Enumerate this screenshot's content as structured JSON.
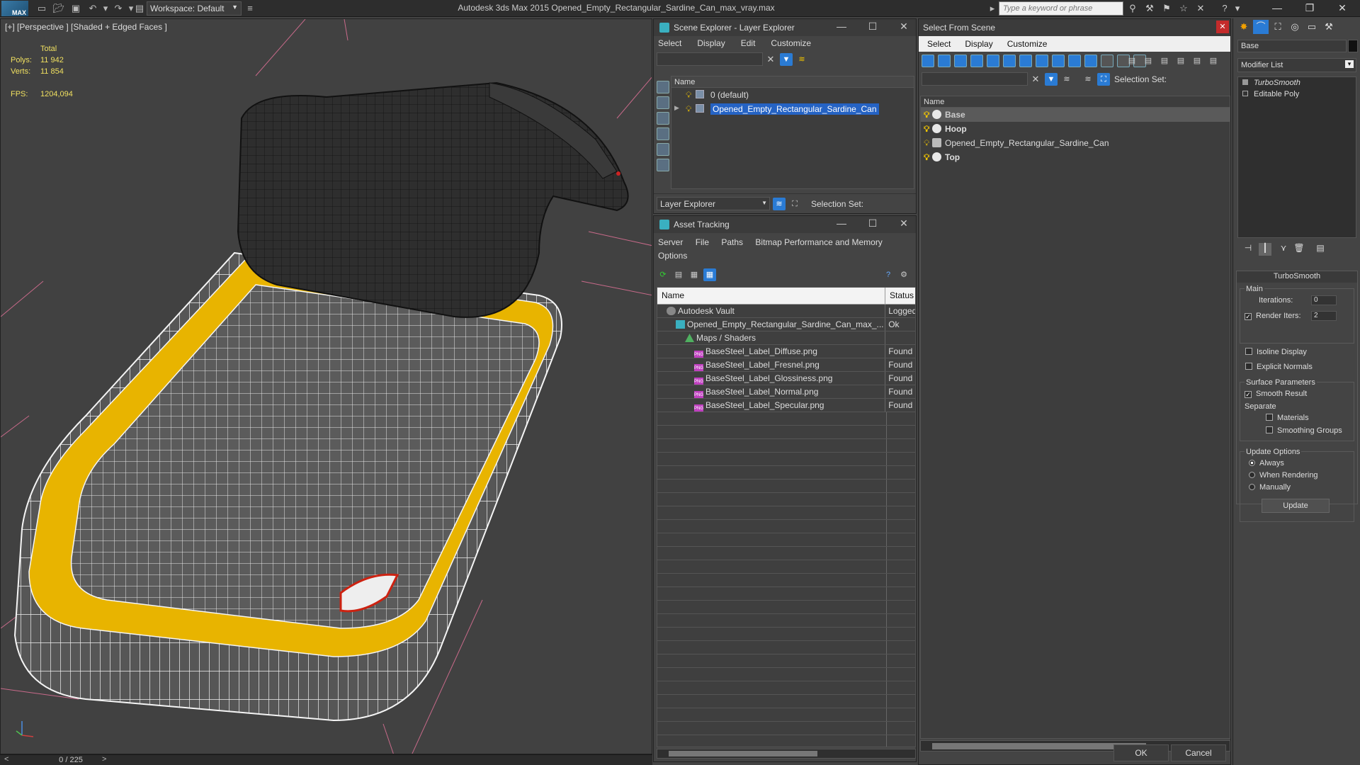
{
  "titlebar": {
    "logo_text": "MAX",
    "workspace": "Workspace: Default",
    "app_title": "Autodesk 3ds Max  2015     Opened_Empty_Rectangular_Sardine_Can_max_vray.max",
    "search_placeholder": "Type a keyword or phrase"
  },
  "viewport": {
    "label": "[+] [Perspective ] [Shaded + Edged Faces ]",
    "stats": {
      "total_label": "Total",
      "polys_label": "Polys:",
      "polys_value": "11 942",
      "verts_label": "Verts:",
      "verts_value": "11 854",
      "fps_label": "FPS:",
      "fps_value": "1204,094"
    },
    "time_counter": "0 / 225"
  },
  "scene_explorer": {
    "title": "Scene Explorer - Layer Explorer",
    "menu": [
      "Select",
      "Display",
      "Edit",
      "Customize"
    ],
    "column_name": "Name",
    "rows": [
      {
        "label": "0 (default)",
        "selected": false
      },
      {
        "label": "Opened_Empty_Rectangular_Sardine_Can",
        "selected": true
      }
    ],
    "layer_dropdown": "Layer Explorer",
    "selection_set_label": "Selection Set:"
  },
  "asset_tracking": {
    "title": "Asset Tracking",
    "menu_line1": [
      "Server",
      "File",
      "Paths",
      "Bitmap Performance and Memory"
    ],
    "menu_line2": [
      "Options"
    ],
    "col_name": "Name",
    "col_status": "Status",
    "rows": [
      {
        "name": "Autodesk Vault",
        "status": "Logged",
        "indent": 1,
        "icon": "vault-icon"
      },
      {
        "name": "Opened_Empty_Rectangular_Sardine_Can_max_...",
        "status": "Ok",
        "indent": 2,
        "icon": "file-icon"
      },
      {
        "name": "Maps / Shaders",
        "status": "",
        "indent": 3,
        "icon": "maps-icon"
      },
      {
        "name": "BaseSteel_Label_Diffuse.png",
        "status": "Found",
        "indent": 4,
        "icon": "png-icon"
      },
      {
        "name": "BaseSteel_Label_Fresnel.png",
        "status": "Found",
        "indent": 4,
        "icon": "png-icon"
      },
      {
        "name": "BaseSteel_Label_Glossiness.png",
        "status": "Found",
        "indent": 4,
        "icon": "png-icon"
      },
      {
        "name": "BaseSteel_Label_Normal.png",
        "status": "Found",
        "indent": 4,
        "icon": "png-icon"
      },
      {
        "name": "BaseSteel_Label_Specular.png",
        "status": "Found",
        "indent": 4,
        "icon": "png-icon"
      }
    ]
  },
  "select_from_scene": {
    "title": "Select From Scene",
    "menu": [
      "Select",
      "Display",
      "Customize"
    ],
    "selection_set_label": "Selection Set:",
    "column_name": "Name",
    "rows": [
      {
        "label": "Base",
        "bold": true,
        "selected": true
      },
      {
        "label": "Hoop",
        "bold": true,
        "selected": false
      },
      {
        "label": "Opened_Empty_Rectangular_Sardine_Can",
        "bold": false,
        "selected": false
      },
      {
        "label": "Top",
        "bold": true,
        "selected": false
      }
    ],
    "ok_label": "OK",
    "cancel_label": "Cancel"
  },
  "command_panel": {
    "object_name": "Base",
    "modifier_list": "Modifier List",
    "stack": [
      "TurboSmooth",
      "Editable Poly"
    ],
    "turbosmooth": {
      "title": "TurboSmooth",
      "main_label": "Main",
      "iterations_label": "Iterations:",
      "iterations_value": "0",
      "render_iters_label": "Render Iters:",
      "render_iters_value": "2",
      "isoline_label": "Isoline Display",
      "explicit_normals_label": "Explicit Normals",
      "surface_params_label": "Surface Parameters",
      "smooth_result_label": "Smooth Result",
      "separate_label": "Separate",
      "materials_label": "Materials",
      "smoothing_groups_label": "Smoothing Groups",
      "update_options_label": "Update Options",
      "always_label": "Always",
      "when_rendering_label": "When Rendering",
      "manually_label": "Manually",
      "update_button": "Update"
    }
  },
  "colors": {
    "accent_selected": "#2563c4",
    "rim_yellow": "#e8b400",
    "stats_yellow": "#f0e060",
    "close_red": "#c42b2b"
  }
}
